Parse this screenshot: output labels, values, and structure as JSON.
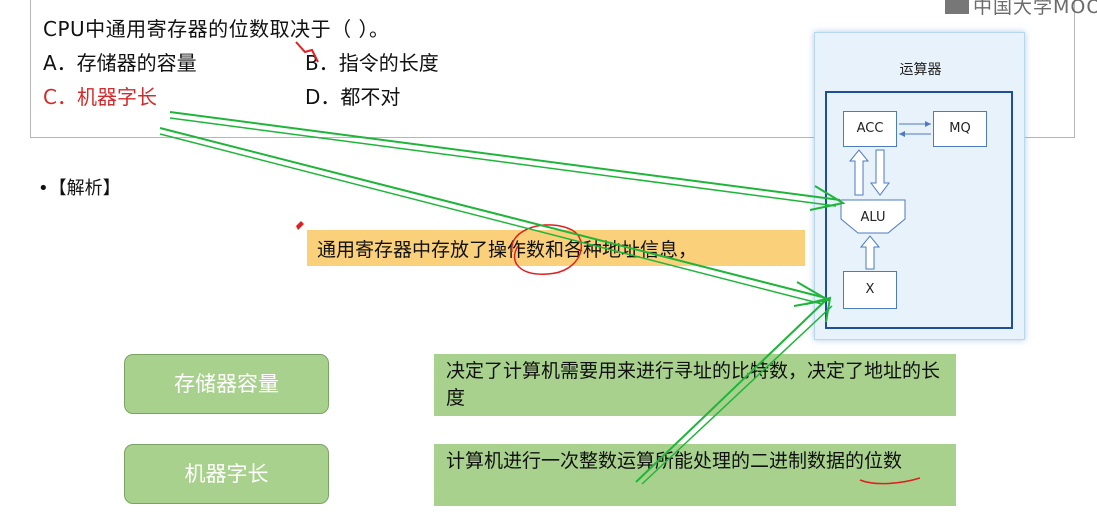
{
  "header": {
    "logo_text": "中国大学MOOC"
  },
  "question": {
    "stem": "CPU中通用寄存器的位数取决于（   ）。",
    "options": [
      {
        "label": "A．存储器的容量"
      },
      {
        "label": "B．指令的长度"
      },
      {
        "label": "C．机器字长"
      },
      {
        "label": "D．都不对"
      }
    ]
  },
  "analysis": {
    "heading": "•【解析】",
    "highlight": "通用寄存器中存放了操作数和各种地址信息，"
  },
  "terms": [
    {
      "name": "存储器容量",
      "description": "决定了计算机需要用来进行寻址的比特数，决定了地址的长度"
    },
    {
      "name": "机器字长",
      "description": "计算机进行一次整数运算所能处理的二进制数据的位数"
    }
  ],
  "diagram": {
    "title": "运算器",
    "acc": "ACC",
    "mq": "MQ",
    "alu": "ALU",
    "x": "X"
  },
  "colors": {
    "term_green": "#a9d18e",
    "highlight_orange": "#fbd07a",
    "correct_option_red": "#d22b2b",
    "annotation_green": "#1fb53a",
    "annotation_red": "#e02020",
    "diagram_blue": "#1f4f9a"
  }
}
